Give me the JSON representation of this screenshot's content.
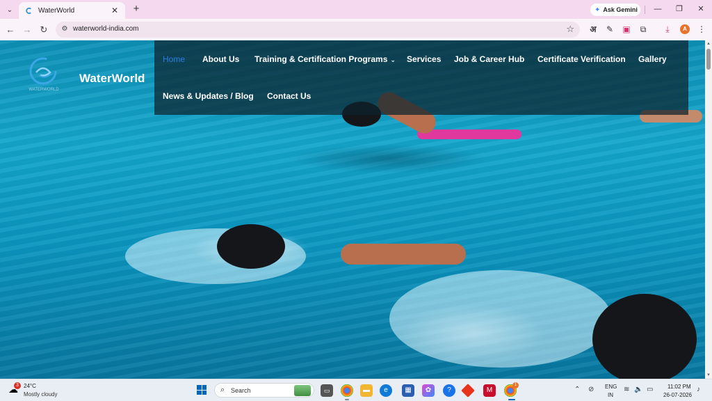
{
  "browser": {
    "tab": {
      "title": "WaterWorld"
    },
    "url": "waterworld-india.com",
    "ask_gemini": "Ask Gemini",
    "profile_initial": "A",
    "extension_lang": "अ"
  },
  "site": {
    "brand_name": "WaterWorld",
    "logo_text": "WATERWORLD",
    "nav": {
      "home": "Home",
      "about": "About Us",
      "training": "Training & Certification Programs",
      "services": "Services",
      "jobs": "Job & Career Hub",
      "verification": "Certificate Verification",
      "gallery": "Gallery",
      "news": "News & Updates / Blog",
      "contact": "Contact Us"
    },
    "active_nav": "Home",
    "colors": {
      "nav_active": "#2a7de1",
      "nav_panel": "#0d232d"
    }
  },
  "taskbar": {
    "weather": {
      "badge": "3",
      "temp": "24°C",
      "desc": "Mostly cloudy"
    },
    "search_placeholder": "Search",
    "lang_top": "ENG",
    "lang_bottom": "IN",
    "time": "11:02 PM",
    "date": "26-07-2026",
    "chrome_badge": "1"
  }
}
